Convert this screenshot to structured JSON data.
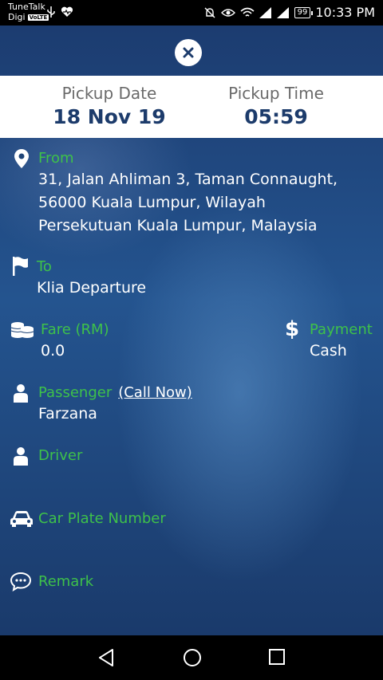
{
  "status_bar": {
    "carrier1": "TuneTalk",
    "carrier2": "Digi",
    "volte": "VoLTE",
    "battery": "99",
    "time": "10:33 PM"
  },
  "booking": {
    "pickup_date_label": "Pickup Date",
    "pickup_date": "18 Nov 19",
    "pickup_time_label": "Pickup Time",
    "pickup_time": "05:59",
    "from_label": "From",
    "from_lines": [
      "31, Jalan Ahliman 3, Taman Connaught,",
      "56000 Kuala Lumpur, Wilayah",
      "Persekutuan Kuala Lumpur, Malaysia"
    ],
    "to_label": "To",
    "to_value": "Klia Departure",
    "fare_label": "Fare (RM)",
    "fare_value": "0.0",
    "payment_label": "Payment",
    "payment_value": "Cash",
    "passenger_label": "Passenger",
    "call_now": "(Call Now)",
    "passenger_value": "Farzana",
    "driver_label": "Driver",
    "car_plate_label": "Car Plate Number",
    "remark_label": "Remark"
  },
  "colors": {
    "accent_green": "#3ec14a",
    "navy": "#1c3b6b"
  },
  "icons": {
    "close": "close-icon",
    "from": "location-pin-icon",
    "to": "flag-icon",
    "fare": "coins-icon",
    "payment": "dollar-icon",
    "passenger": "person-icon",
    "driver": "person-icon",
    "car": "car-icon",
    "remark": "chat-bubble-icon"
  }
}
